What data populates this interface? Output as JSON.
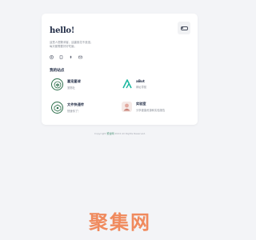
{
  "header": {
    "greeting": "hello!",
    "intro_line_1": "這是人間驚鴻客，這裏風花不浪漫。",
    "intro_line_2": "每天都需要好好吃飯。"
  },
  "social_icons": [
    "github-icon",
    "document-icon",
    "pin-icon",
    "mail-icon"
  ],
  "theme_toggle": {
    "icon": "toggle-icon"
  },
  "sites": {
    "title": "我的站点",
    "items": [
      {
        "name": "喜宠星球",
        "desc": "宠物社",
        "logo": "pet-planet-logo",
        "accent": "#2c6e4a"
      },
      {
        "name": "aBot",
        "desc": "网址导航",
        "logo": "abot-logo",
        "accent": "#1fb8a0"
      },
      {
        "name": "文件快速传",
        "desc": "快速传了！",
        "logo": "file-transfer-logo",
        "accent": "#2c6e4a"
      },
      {
        "name": "实验室",
        "desc": "分享健康资源和实验报告",
        "logo": "lab-logo",
        "accent": "#e3a99f"
      }
    ]
  },
  "footer": {
    "prefix": "Copyright ",
    "link": "聚合网",
    "suffix": " 2024 All Rights Reserved."
  },
  "watermark": "聚集网",
  "colors": {
    "background": "#f3f4f7",
    "card": "#ffffff",
    "heading": "#1f2a44",
    "muted": "#8a8f99",
    "watermark": "#f08a5d"
  }
}
